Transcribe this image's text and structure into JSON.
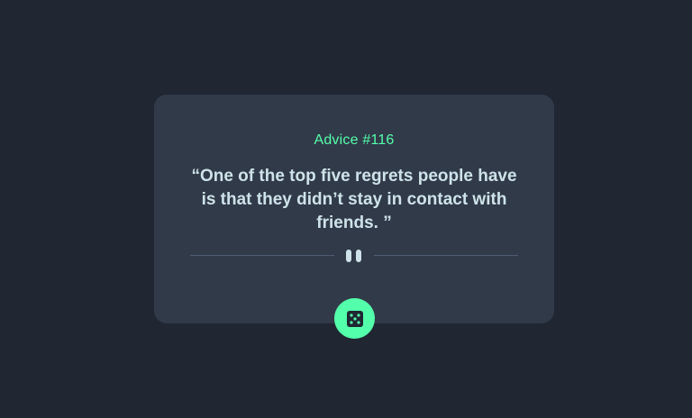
{
  "card": {
    "advice_label": "Advice #116",
    "quote": "“One of the top five regrets people have is that they didn’t stay in contact with friends. ”"
  },
  "divider": {
    "icon": "pause-icon"
  },
  "dice_button": {
    "icon": "dice-icon"
  },
  "colors": {
    "background": "#202632",
    "card": "#313a49",
    "accent": "#53ffaa",
    "text": "#cee3e9",
    "divider": "#4f5d74"
  }
}
